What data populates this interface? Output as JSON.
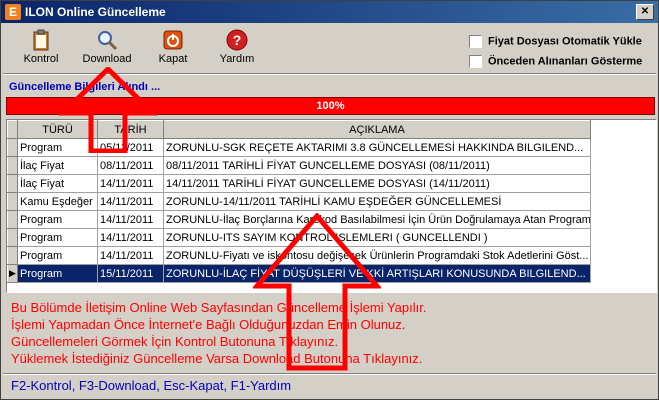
{
  "window": {
    "title": "ILON Online Güncelleme",
    "app_icon": "E",
    "close_glyph": "✕"
  },
  "toolbar": {
    "buttons": [
      {
        "label": "Kontrol",
        "icon": "clipboard-icon"
      },
      {
        "label": "Download",
        "icon": "magnifier-icon"
      },
      {
        "label": "Kapat",
        "icon": "power-icon"
      },
      {
        "label": "Yardım",
        "icon": "help-icon"
      }
    ],
    "checkboxes": [
      {
        "label": "Fiyat Dosyası Otomatik Yükle",
        "checked": false
      },
      {
        "label": "Önceden Alınanları Gösterme",
        "checked": false
      }
    ]
  },
  "status": {
    "text": "Güncelleme Bilgileri Alındı ...",
    "progress_percent": 100,
    "progress_label": "100%"
  },
  "table": {
    "columns": [
      "TÜRÜ",
      "TARİH",
      "AÇIKLAMA"
    ],
    "rows": [
      {
        "type": "Program",
        "date": "05/11/2011",
        "desc": "ZORUNLU-SGK REÇETE AKTARIMI 3.8  GÜNCELLEMESİ HAKKINDA BILGILEND..."
      },
      {
        "type": "İlaç Fiyat",
        "date": "08/11/2011",
        "desc": "08/11/2011 TARİHLİ FİYAT GUNCELLEME DOSYASI (08/11/2011)"
      },
      {
        "type": "İlaç Fiyat",
        "date": "14/11/2011",
        "desc": "14/11/2011 TARİHLİ FİYAT GUNCELLEME DOSYASI (14/11/2011)"
      },
      {
        "type": "Kamu Eşdeğer",
        "date": "14/11/2011",
        "desc": "ZORUNLU-14/11/2011 TARİHLİ KAMU EŞDEĞER GÜNCELLEMESİ"
      },
      {
        "type": "Program",
        "date": "14/11/2011",
        "desc": "ZORUNLU-İlaç Borçlarına Karekod Basılabilmesi İçin Ürün Doğrulamaya Atan Program ("
      },
      {
        "type": "Program",
        "date": "14/11/2011",
        "desc": "ZORUNLU-ITS SAYIM KONTROL ISLEMLERI ( GUNCELLENDI )"
      },
      {
        "type": "Program",
        "date": "14/11/2011",
        "desc": "ZORUNLU-Fiyatı ve iskontosu değişecek Ürünlerin Programdaki Stok Adetlerini Göst..."
      },
      {
        "type": "Program",
        "date": "15/11/2011",
        "desc": "ZORUNLU-İLAÇ FİYAT DÜŞÜŞLERİ VE KKİ ARTIŞLARI KONUSUNDA BILGILEND...",
        "selected": true
      }
    ],
    "row_indicator": "▶"
  },
  "message": {
    "lines": [
      "Bu Bölümde İletişim Online Web Sayfasından Güncelleme İşlemi Yapılır.",
      "İşlemi Yapmadan Önce İnternet'e Bağlı Olduğunuzdan Emin Olunuz.",
      "Güncellemeleri Görmek İçin Kontrol Butonuna Tıklayınız.",
      "Yüklemek İstediğiniz Güncelleme Varsa Download Butonuna Tıklayınız."
    ]
  },
  "footer": {
    "shortcuts": "F2-Kontrol,  F3-Download,  Esc-Kapat,   F1-Yardım"
  },
  "colors": {
    "title_bar": "#0a246a",
    "progress": "#ff0000",
    "message": "#ff0000",
    "selection": "#0a246a",
    "link_blue": "#0000c0"
  }
}
